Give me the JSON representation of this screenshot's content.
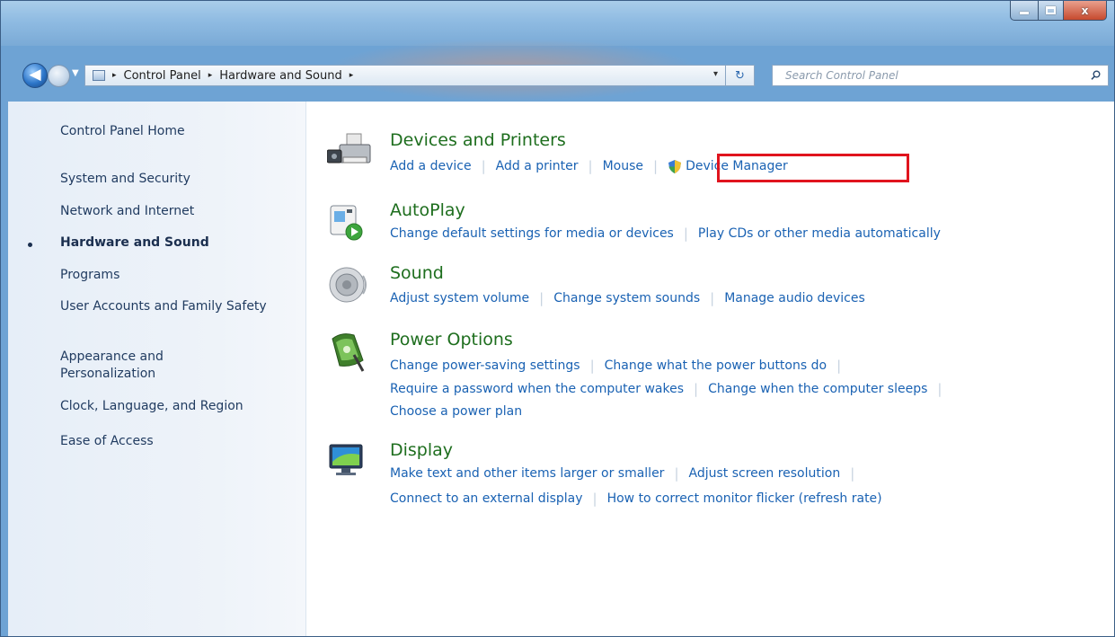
{
  "window": {
    "controls": {
      "minimize": "–",
      "maximize": "□",
      "close": "x"
    }
  },
  "nav": {
    "back_icon": "back-arrow-icon",
    "forward_icon": "forward-arrow-icon",
    "breadcrumb": [
      "Control Panel",
      "Hardware and Sound"
    ],
    "breadcrumb_separator": "▸",
    "address_dropdown": "▾",
    "refresh_glyph": "↻",
    "search": {
      "placeholder": "Search Control Panel",
      "value": ""
    }
  },
  "sidebar": {
    "items": [
      {
        "label": "Control Panel Home"
      },
      {
        "label": "System and Security"
      },
      {
        "label": "Network and Internet"
      },
      {
        "label": "Hardware and Sound",
        "current": true
      },
      {
        "label": "Programs"
      },
      {
        "label": "User Accounts and Family Safety"
      },
      {
        "label": "Appearance and Personalization"
      },
      {
        "label": "Clock, Language, and Region"
      },
      {
        "label": "Ease of Access"
      }
    ]
  },
  "categories": [
    {
      "title": "Devices and Printers",
      "icon": "printer-icon",
      "rows": [
        [
          "Add a device",
          "Add a printer",
          "Mouse",
          "Device Manager"
        ]
      ]
    },
    {
      "title": "AutoPlay",
      "icon": "autoplay-icon",
      "rows": [
        [
          "Change default settings for media or devices",
          "Play CDs or other media automatically"
        ]
      ]
    },
    {
      "title": "Sound",
      "icon": "speaker-icon",
      "rows": [
        [
          "Adjust system volume",
          "Change system sounds",
          "Manage audio devices"
        ]
      ]
    },
    {
      "title": "Power Options",
      "icon": "battery-icon",
      "rows": [
        [
          "Change power-saving settings",
          "Change what the power buttons do"
        ],
        [
          "Require a password when the computer wakes",
          "Change when the computer sleeps"
        ],
        [
          "Choose a power plan"
        ]
      ]
    },
    {
      "title": "Display",
      "icon": "monitor-icon",
      "rows": [
        [
          "Make text and other items larger or smaller",
          "Adjust screen resolution"
        ],
        [
          "Connect to an external display",
          "How to correct monitor flicker (refresh rate)"
        ]
      ]
    }
  ],
  "colors": {
    "category_title": "#1e6e1e",
    "link": "#1a62b3",
    "highlight": "#e0141e",
    "titlebar": "#8fbbe2"
  }
}
